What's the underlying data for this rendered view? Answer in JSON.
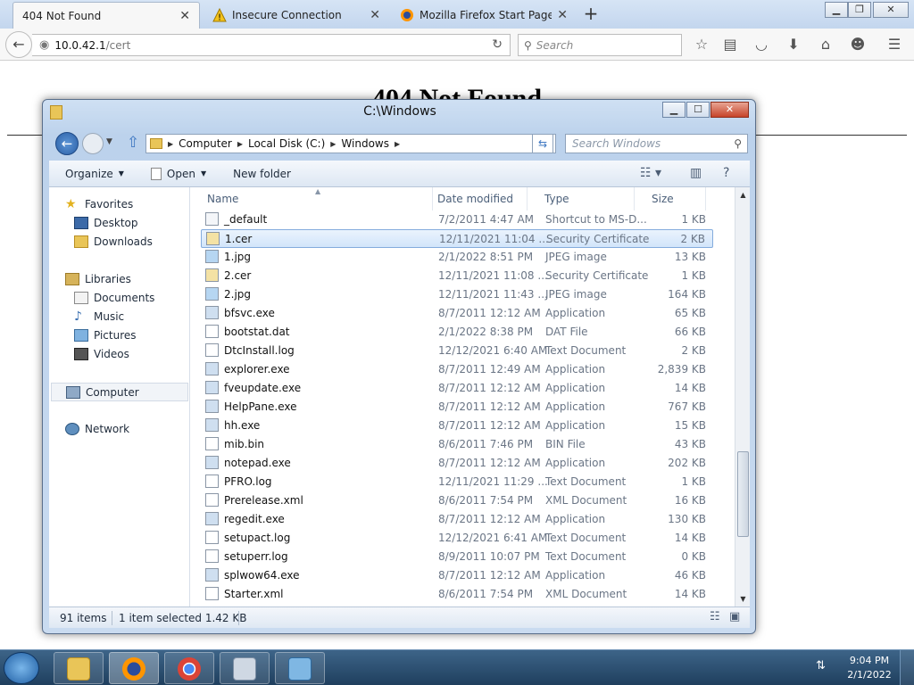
{
  "browser": {
    "tabs": [
      {
        "label": "404 Not Found"
      },
      {
        "label": "Insecure Connection"
      },
      {
        "label": "Mozilla Firefox Start Page"
      }
    ],
    "url_host": "10.0.42.1",
    "url_path": "/cert",
    "search_placeholder": "Search"
  },
  "page": {
    "heading": "404 Not Found"
  },
  "explorer": {
    "title": "C:\\Windows",
    "breadcrumbs": [
      "Computer",
      "Local Disk (C:)",
      "Windows"
    ],
    "search_placeholder": "Search Windows",
    "commands": {
      "organize": "Organize",
      "open": "Open",
      "new_folder": "New folder"
    },
    "nav": {
      "favorites": "Favorites",
      "desktop": "Desktop",
      "downloads": "Downloads",
      "libraries": "Libraries",
      "documents": "Documents",
      "music": "Music",
      "pictures": "Pictures",
      "videos": "Videos",
      "computer": "Computer",
      "network": "Network"
    },
    "columns": {
      "name": "Name",
      "date": "Date modified",
      "type": "Type",
      "size": "Size"
    },
    "files": [
      {
        "name": "_default",
        "date": "7/2/2011 4:47 AM",
        "type": "Shortcut to MS-D...",
        "size": "1 KB"
      },
      {
        "name": "1.cer",
        "date": "12/11/2021 11:04 ...",
        "type": "Security Certificate",
        "size": "2 KB"
      },
      {
        "name": "1.jpg",
        "date": "2/1/2022 8:51 PM",
        "type": "JPEG image",
        "size": "13 KB"
      },
      {
        "name": "2.cer",
        "date": "12/11/2021 11:08 ...",
        "type": "Security Certificate",
        "size": "1 KB"
      },
      {
        "name": "2.jpg",
        "date": "12/11/2021 11:43 ...",
        "type": "JPEG image",
        "size": "164 KB"
      },
      {
        "name": "bfsvc.exe",
        "date": "8/7/2011 12:12 AM",
        "type": "Application",
        "size": "65 KB"
      },
      {
        "name": "bootstat.dat",
        "date": "2/1/2022 8:38 PM",
        "type": "DAT File",
        "size": "66 KB"
      },
      {
        "name": "DtcInstall.log",
        "date": "12/12/2021 6:40 AM",
        "type": "Text Document",
        "size": "2 KB"
      },
      {
        "name": "explorer.exe",
        "date": "8/7/2011 12:49 AM",
        "type": "Application",
        "size": "2,839 KB"
      },
      {
        "name": "fveupdate.exe",
        "date": "8/7/2011 12:12 AM",
        "type": "Application",
        "size": "14 KB"
      },
      {
        "name": "HelpPane.exe",
        "date": "8/7/2011 12:12 AM",
        "type": "Application",
        "size": "767 KB"
      },
      {
        "name": "hh.exe",
        "date": "8/7/2011 12:12 AM",
        "type": "Application",
        "size": "15 KB"
      },
      {
        "name": "mib.bin",
        "date": "8/6/2011 7:46 PM",
        "type": "BIN File",
        "size": "43 KB"
      },
      {
        "name": "notepad.exe",
        "date": "8/7/2011 12:12 AM",
        "type": "Application",
        "size": "202 KB"
      },
      {
        "name": "PFRO.log",
        "date": "12/11/2021 11:29 ...",
        "type": "Text Document",
        "size": "1 KB"
      },
      {
        "name": "Prerelease.xml",
        "date": "8/6/2011 7:54 PM",
        "type": "XML Document",
        "size": "16 KB"
      },
      {
        "name": "regedit.exe",
        "date": "8/7/2011 12:12 AM",
        "type": "Application",
        "size": "130 KB"
      },
      {
        "name": "setupact.log",
        "date": "12/12/2021 6:41 AM",
        "type": "Text Document",
        "size": "14 KB"
      },
      {
        "name": "setuperr.log",
        "date": "8/9/2011 10:07 PM",
        "type": "Text Document",
        "size": "0 KB"
      },
      {
        "name": "splwow64.exe",
        "date": "8/7/2011 12:12 AM",
        "type": "Application",
        "size": "46 KB"
      },
      {
        "name": "Starter.xml",
        "date": "8/6/2011 7:54 PM",
        "type": "XML Document",
        "size": "14 KB"
      }
    ],
    "selected_index": 1,
    "status": {
      "count": "91 items",
      "selection": "1 item selected 1.42 KB"
    }
  },
  "taskbar": {
    "time": "9:04 PM",
    "date": "2/1/2022"
  }
}
